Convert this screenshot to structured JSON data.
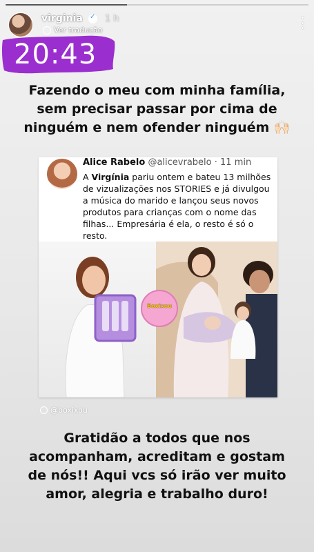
{
  "story": {
    "progress": 0.4,
    "username": "virginia",
    "time_ago": "1 h",
    "translate_label": "Ver tradução"
  },
  "sticker": {
    "clock": "20:43"
  },
  "captions": {
    "top": "Fazendo o meu com minha família, sem precisar passar por cima de ninguém e nem ofender ninguém 🙌🏻",
    "bottom": "Gratidão a todos que nos acompanham, acreditam e gostam de nós!! Aqui vcs só irão ver muito amor, alegria e trabalho duro!"
  },
  "tweet": {
    "name": "Alice Rabelo",
    "handle": "@alicevrabelo · 11 min",
    "text_pre": "A ",
    "text_bold": "Virgínia",
    "text_post": " pariu ontem e bateu 13 milhões de vizualizações nos STORIES e já divulgou a música do marido e lançou seus novos produtos para crianças com o nome das filhas... Empresária é ela, o resto é só o resto.",
    "watermark": "Boxixou"
  },
  "credit": "@boxixou",
  "colors": {
    "sticker": "#9b2ecf"
  }
}
